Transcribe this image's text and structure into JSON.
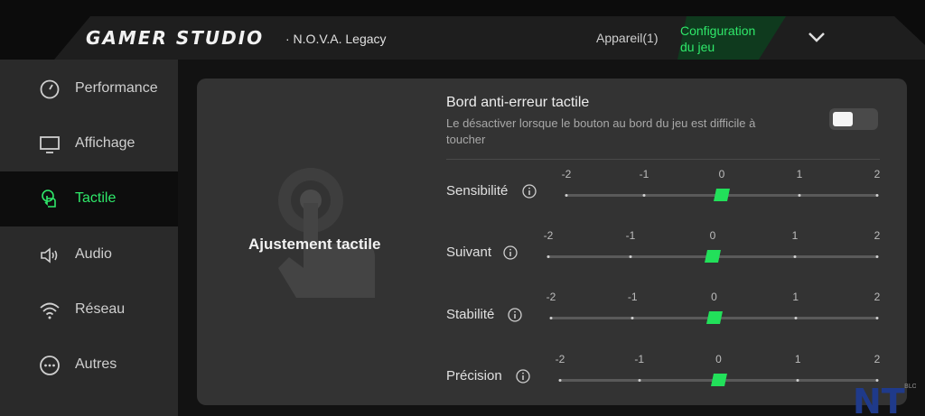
{
  "header": {
    "brand": "GAMER STUDIO",
    "subtitle": "· N.O.V.A. Legacy",
    "device_tab": "Appareil(1)",
    "config_tab_line1": "Configuration",
    "config_tab_line2": "du jeu",
    "accent_color": "#2fe86a"
  },
  "sidebar": {
    "items": [
      {
        "label": "Performance",
        "icon": "gauge-icon"
      },
      {
        "label": "Affichage",
        "icon": "monitor-icon"
      },
      {
        "label": "Tactile",
        "icon": "touch-icon",
        "active": true
      },
      {
        "label": "Audio",
        "icon": "speaker-icon"
      },
      {
        "label": "Réseau",
        "icon": "wifi-icon"
      },
      {
        "label": "Autres",
        "icon": "more-icon"
      }
    ]
  },
  "panel": {
    "title": "Ajustement tactile",
    "option": {
      "title": "Bord anti-erreur tactile",
      "description": "Le désactiver lorsque le bouton au bord du jeu est difficile à toucher",
      "enabled": false
    },
    "tick_labels": [
      "-2",
      "-1",
      "0",
      "1",
      "2"
    ],
    "sliders": [
      {
        "label": "Sensibilité",
        "value": 0
      },
      {
        "label": "Suivant",
        "value": 0
      },
      {
        "label": "Stabilité",
        "value": 0
      },
      {
        "label": "Précision",
        "value": 0
      }
    ]
  },
  "watermark": {
    "text": "NT",
    "small": "BLOG"
  }
}
